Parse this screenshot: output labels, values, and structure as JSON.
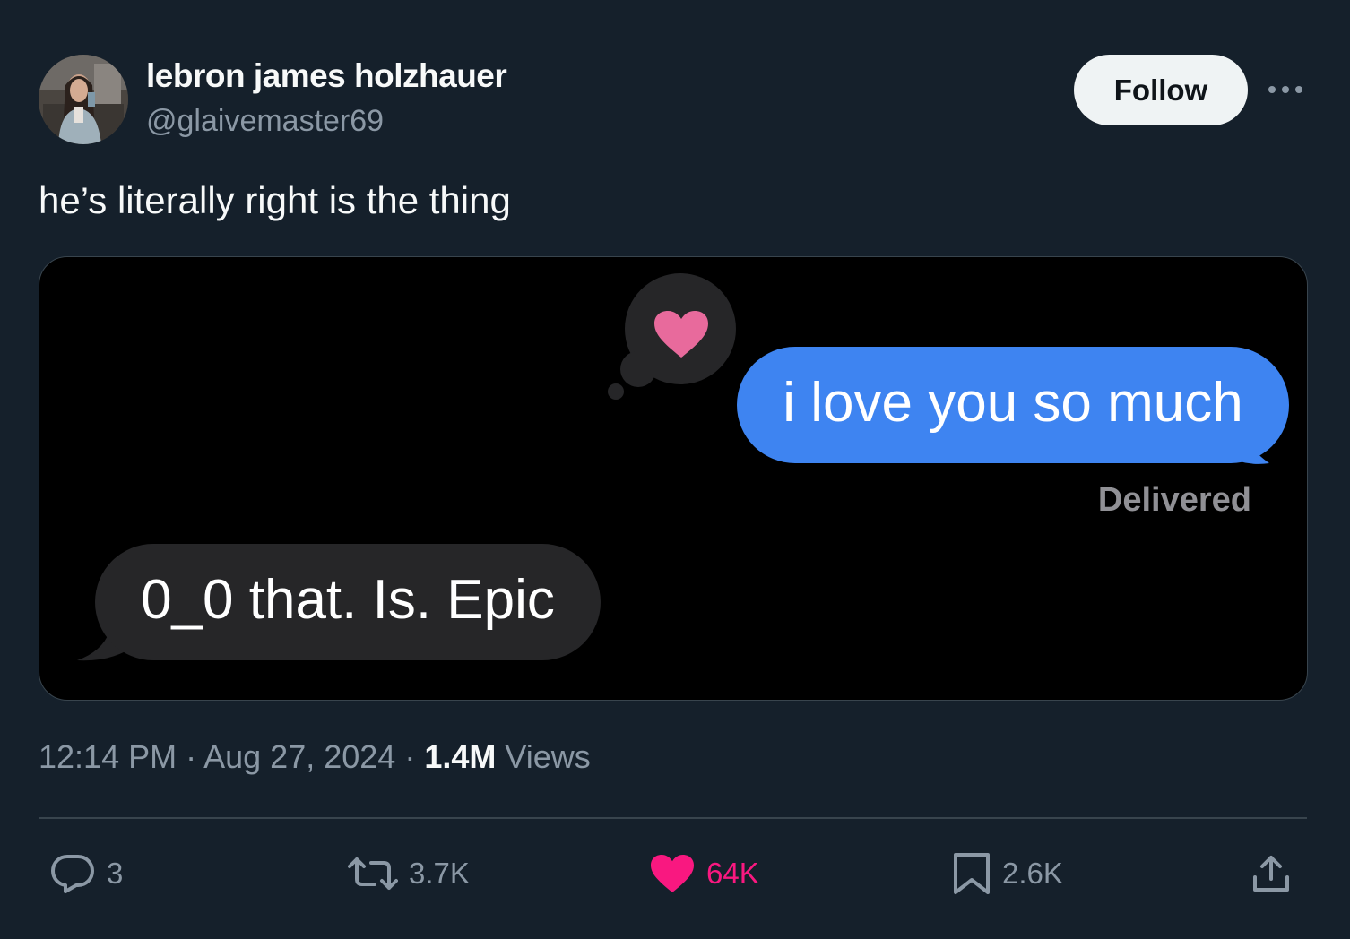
{
  "author": {
    "name": "lebron james holzhauer",
    "handle": "@glaivemaster69",
    "avatar_icon": "profile-photo"
  },
  "follow_button": {
    "label": "Follow"
  },
  "more_icon": "more-horizontal-icon",
  "tweet_text": "he’s literally right is the thing",
  "media": {
    "background": "#000000",
    "sent_message": {
      "text": "i love you so much",
      "color": "#3e84f1",
      "reaction_icon": "heart-icon",
      "reaction_color": "#e86a9c"
    },
    "delivered_label": "Delivered",
    "received_message": {
      "text": "0_0 that. Is. Epic",
      "color": "#262628"
    }
  },
  "meta": {
    "time": "12:14 PM",
    "separator": "·",
    "date": "Aug 27, 2024",
    "views_count": "1.4M",
    "views_label": "Views"
  },
  "actions": {
    "replies": {
      "icon": "reply-icon",
      "count": "3"
    },
    "retweets": {
      "icon": "retweet-icon",
      "count": "3.7K"
    },
    "likes": {
      "icon": "heart-filled-icon",
      "count": "64K",
      "color": "#f91880",
      "liked": true
    },
    "bookmarks": {
      "icon": "bookmark-icon",
      "count": "2.6K"
    },
    "share": {
      "icon": "share-icon"
    }
  },
  "colors": {
    "background": "#15202b",
    "text_primary": "#f7f9f9",
    "text_secondary": "#8b98a5",
    "divider": "#38444d"
  }
}
